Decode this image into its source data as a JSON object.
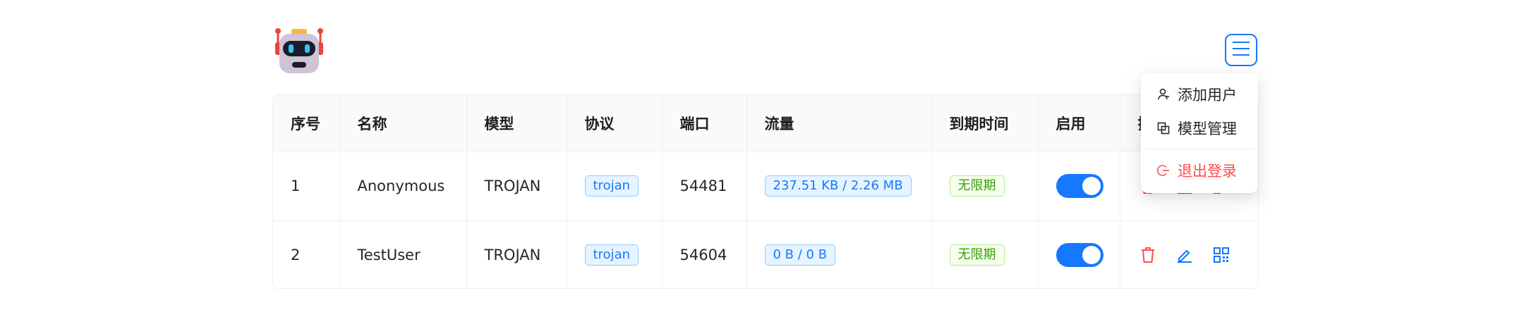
{
  "header": {
    "logo_icon": "robot-icon",
    "menu_icon": "hamburger-menu-icon"
  },
  "table": {
    "columns": [
      "序号",
      "名称",
      "模型",
      "协议",
      "端口",
      "流量",
      "到期时间",
      "启用",
      "操作"
    ],
    "rows": [
      {
        "index": "1",
        "name": "Anonymous",
        "model": "TROJAN",
        "protocol": "trojan",
        "port": "54481",
        "traffic": "237.51 KB / 2.26 MB",
        "expiry": "无限期",
        "enabled": true
      },
      {
        "index": "2",
        "name": "TestUser",
        "model": "TROJAN",
        "protocol": "trojan",
        "port": "54604",
        "traffic": "0 B / 0 B",
        "expiry": "无限期",
        "enabled": true
      }
    ],
    "actions": [
      "delete-icon",
      "edit-icon",
      "qrcode-icon"
    ]
  },
  "dropdown": {
    "items": [
      {
        "label": "添加用户",
        "icon": "user-add-icon"
      },
      {
        "label": "模型管理",
        "icon": "copy-icon"
      },
      {
        "label": "退出登录",
        "icon": "logout-icon"
      }
    ]
  },
  "colors": {
    "primary": "#1677ff",
    "danger": "#ff4d4f",
    "success": "#389e0d"
  }
}
